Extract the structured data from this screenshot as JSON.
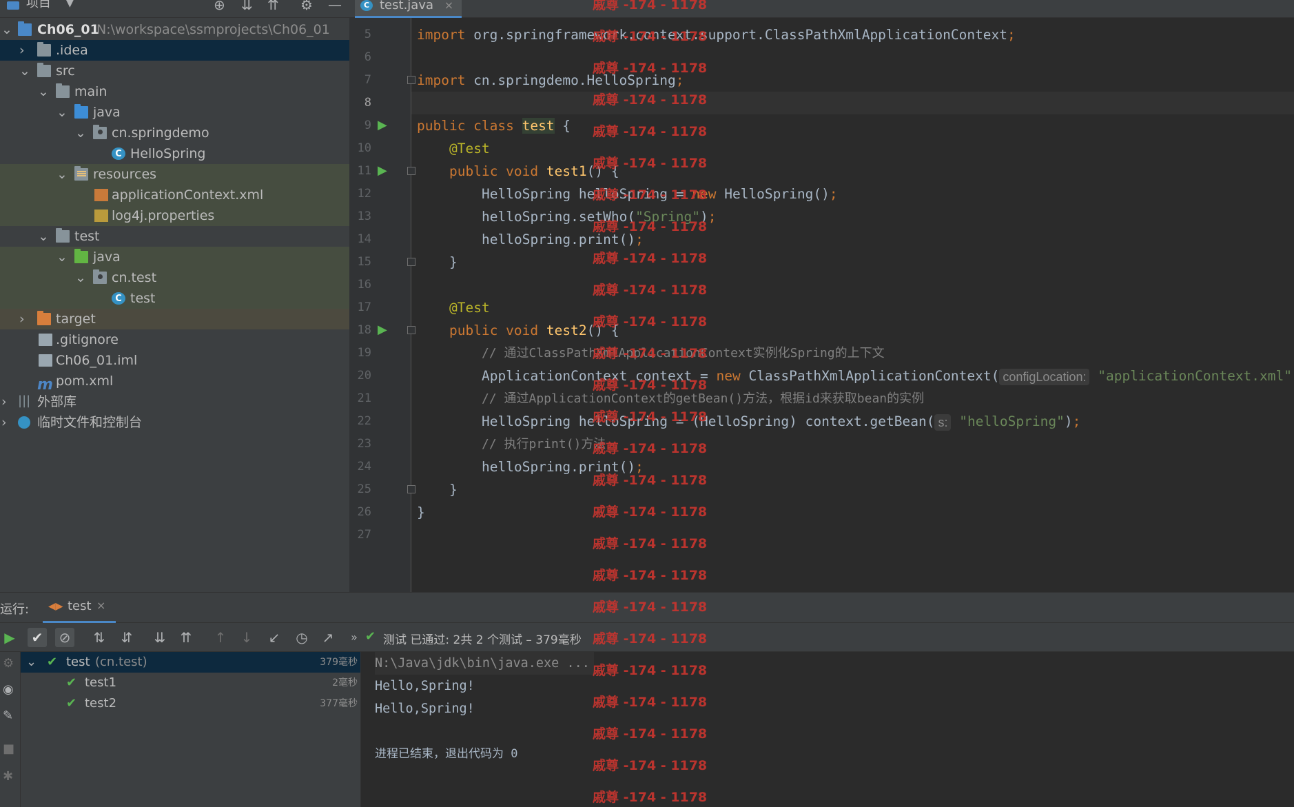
{
  "project": {
    "header_label": "项目",
    "tree": [
      {
        "label": "Ch06_01",
        "suffix": "N:\\workspace\\ssmprojects\\Ch06_01"
      },
      {
        "label": ".idea"
      },
      {
        "label": "src"
      },
      {
        "label": "main"
      },
      {
        "label": "java"
      },
      {
        "label": "cn.springdemo"
      },
      {
        "label": "HelloSpring"
      },
      {
        "label": "resources"
      },
      {
        "label": "applicationContext.xml"
      },
      {
        "label": "log4j.properties"
      },
      {
        "label": "test"
      },
      {
        "label": "java"
      },
      {
        "label": "cn.test"
      },
      {
        "label": "test"
      },
      {
        "label": "target"
      },
      {
        "label": ".gitignore"
      },
      {
        "label": "Ch06_01.iml"
      },
      {
        "label": "pom.xml"
      },
      {
        "label": "外部库"
      },
      {
        "label": "临时文件和控制台"
      }
    ]
  },
  "editor": {
    "tab_label": "test.java",
    "line_numbers": [
      "5",
      "6",
      "7",
      "8",
      "9",
      "10",
      "11",
      "12",
      "13",
      "14",
      "15",
      "16",
      "17",
      "18",
      "19",
      "20",
      "21",
      "22",
      "23",
      "24",
      "25",
      "26",
      "27"
    ],
    "code": {
      "l5a": "import ",
      "l5b": "org.springframework.context.support.ClassPathXmlApplicationContext",
      "l5c": ";",
      "l7a": "import ",
      "l7b": "cn.springdemo.HelloSpring",
      "l7c": ";",
      "l9a": "public class ",
      "l9b": "test",
      "l9c": " {",
      "l10": "@Test",
      "l11a": "public void ",
      "l11b": "test1",
      "l11c": "() {",
      "l12a": "HelloSpring helloSpring = ",
      "l12b": "new ",
      "l12c": "HelloSpring()",
      "l12d": ";",
      "l13a": "helloSpring.setWho(",
      "l13b": "\"Spring\"",
      "l13c": ")",
      "l13d": ";",
      "l14a": "helloSpring.print()",
      "l14b": ";",
      "l15": "}",
      "l17": "@Test",
      "l18a": "public void ",
      "l18b": "test2",
      "l18c": "() {",
      "l19": "// 通过ClassPathXmlApplicationContext实例化Spring的上下文",
      "l20a": "ApplicationContext context = ",
      "l20b": "new ",
      "l20c": "ClassPathXmlApplicationContext(",
      "l20hint": "configLocation:",
      "l20d": "\"applicationContext.xml\"",
      "l21": "// 通过ApplicationContext的getBean()方法，根据id来获取bean的实例",
      "l22a": "HelloSpring helloSpring = (HelloSpring) context.getBean(",
      "l22hint": "s:",
      "l22b": "\"helloSpring\"",
      "l22c": ")",
      "l22d": ";",
      "l23": "// 执行print()方法",
      "l24a": "helloSpring.print()",
      "l24b": ";",
      "l25": "}",
      "l26": "}"
    }
  },
  "watermark": "戚尊 -174 - 1178",
  "run": {
    "label": "运行:",
    "tab_label": "test",
    "status": "测试 已通过: 2共 2 个测试 – 379毫秒",
    "tests": [
      {
        "name": "test",
        "suffix": "(cn.test)",
        "time": "379毫秒"
      },
      {
        "name": "test1",
        "time": "2毫秒"
      },
      {
        "name": "test2",
        "time": "377毫秒"
      }
    ],
    "console": [
      "N:\\Java\\jdk\\bin\\java.exe ...",
      "Hello,Spring!",
      "Hello,Spring!",
      "",
      "进程已结束，退出代码为 0"
    ]
  },
  "colors": {
    "selection": "#0d293e",
    "keyword": "#cc7832",
    "string": "#6a8759",
    "annotation": "#bbb529",
    "method": "#ffc66d",
    "pass_green": "#5ab552",
    "watermark": "#c8352f"
  }
}
